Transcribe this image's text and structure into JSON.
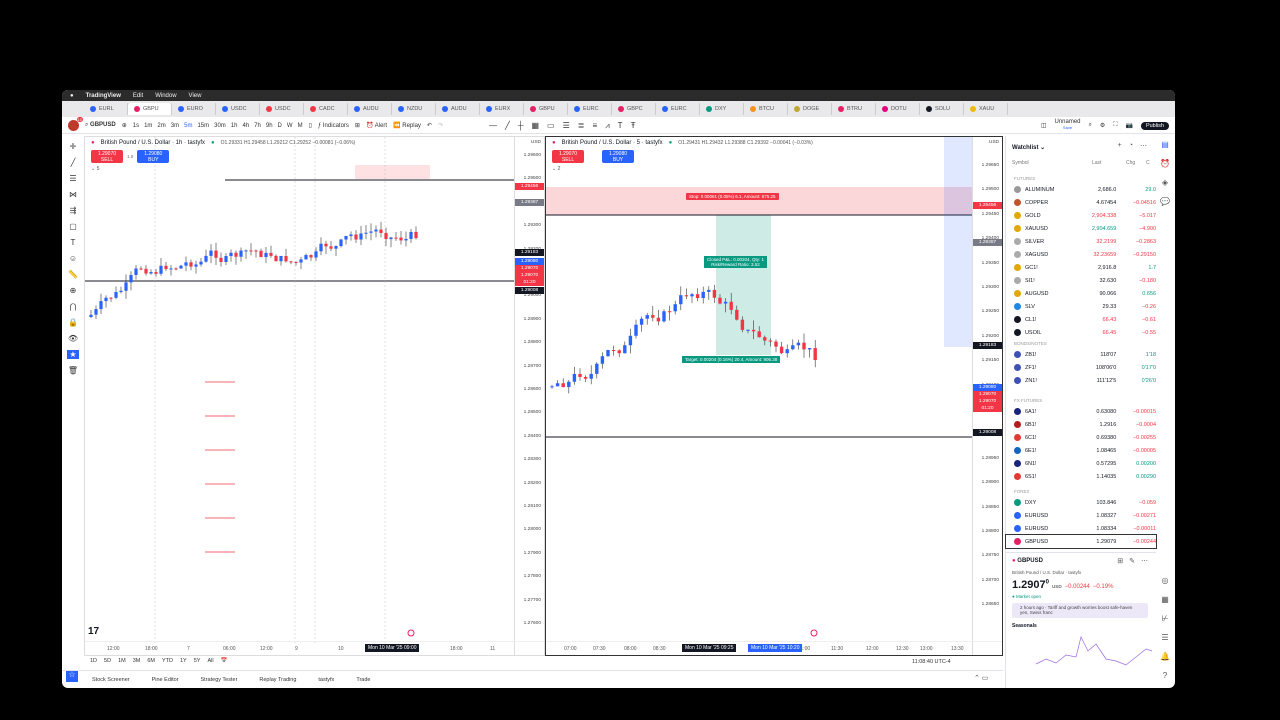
{
  "menubar": {
    "app": "TradingView",
    "items": [
      "Edit",
      "Window",
      "View"
    ]
  },
  "tabs": [
    {
      "label": "EURL",
      "color": "#2962ff"
    },
    {
      "label": "GBPU",
      "color": "#e91e63",
      "active": true
    },
    {
      "label": "EURO",
      "color": "#2962ff"
    },
    {
      "label": "USDC",
      "color": "#2962ff"
    },
    {
      "label": "USDC",
      "color": "#f23645"
    },
    {
      "label": "CADC",
      "color": "#f23645"
    },
    {
      "label": "AUDU",
      "color": "#2962ff"
    },
    {
      "label": "NZDU",
      "color": "#2962ff"
    },
    {
      "label": "AUDU",
      "color": "#2962ff"
    },
    {
      "label": "EURX",
      "color": "#2962ff"
    },
    {
      "label": "GBPU",
      "color": "#e91e63"
    },
    {
      "label": "EURC",
      "color": "#2962ff"
    },
    {
      "label": "GBPC",
      "color": "#e91e63"
    },
    {
      "label": "EURC",
      "color": "#2962ff"
    },
    {
      "label": "DXY",
      "color": "#089981"
    },
    {
      "label": "BTCU",
      "color": "#f7931a"
    },
    {
      "label": "DOGE",
      "color": "#c2a633"
    },
    {
      "label": "BTRU",
      "color": "#e91e63"
    },
    {
      "label": "DOTU",
      "color": "#e6007a"
    },
    {
      "label": "SOLU",
      "color": "#131722"
    },
    {
      "label": "XAUU",
      "color": "#f0b90b"
    }
  ],
  "toolbar": {
    "avatar_badge": "10",
    "symbol": "GBPUSD",
    "intervals": [
      "1s",
      "1m",
      "2m",
      "3m",
      "5m",
      "15m",
      "30m",
      "1h",
      "4h",
      "7h",
      "9h",
      "D",
      "W",
      "M"
    ],
    "active_interval": "5m",
    "indicators": "Indicators",
    "alert": "Alert",
    "replay": "Replay",
    "layout_name": "Unnamed",
    "layout_status": "Save",
    "publish": "Publish"
  },
  "chart1": {
    "title": "British Pound / U.S. Dollar · 1h · tastyfx",
    "ohlc": "O1.29331 H1.29458 L1.29212 C1.29252 −0.00081 (−0.06%)",
    "sell_price": "1.29070",
    "sell": "SELL",
    "spread": "1.0",
    "buy_price": "1.29080",
    "buy": "BUY",
    "lots": "5",
    "currency": "USD",
    "price_labels": [
      "1.29600",
      "1.29500",
      "1.29400",
      "1.29300",
      "1.29200",
      "1.29100",
      "1.29000",
      "1.28900",
      "1.28800",
      "1.28700",
      "1.28600",
      "1.28500",
      "1.28400",
      "1.28300",
      "1.28200",
      "1.28100",
      "1.28000",
      "1.27900",
      "1.27800",
      "1.27700",
      "1.27600"
    ],
    "tags": {
      "stop": "1.29456",
      "entry": "1.29387",
      "last": "1.29183",
      "ask_label": "Ask",
      "ask": "1.29080",
      "bid_label": "Bid",
      "bid": "1.29070",
      "sym": "GBPUSD",
      "sym_price": "1.29070",
      "countdown": "01:20",
      "line": "1.29008"
    },
    "time_labels": [
      "12:00",
      "18:00",
      "7",
      "06:00",
      "12:00",
      "9",
      "10",
      "18:00",
      "11"
    ],
    "crosshair_time": "Mon 10 Mar '25  09:00"
  },
  "chart2": {
    "title": "British Pound / U.S. Dollar · 5 · tastyfx",
    "ohlc": "O1.29431 H1.29432 L1.29388 C1.29392 −0.00041 (−0.03%)",
    "sell_price": "1.29070",
    "sell": "SELL",
    "buy_price": "1.29080",
    "buy": "BUY",
    "lots": "2",
    "currency": "USD",
    "price_labels": [
      "1.29650",
      "1.29500",
      "1.29450",
      "1.29400",
      "1.29350",
      "1.29300",
      "1.29250",
      "1.29200",
      "1.29150",
      "1.29100",
      "1.29050",
      "1.29000",
      "1.28950",
      "1.28900",
      "1.28850",
      "1.28800",
      "1.28750",
      "1.28700",
      "1.28650"
    ],
    "stop_label": "Stop: 0.00061 (0.05%) 6.1, Amount: 675.25",
    "pnl_label": "Closed P&L: 0.00204, Qty: 1",
    "rr_label": "Risk/Reward Ratio: 3.52",
    "target_label": "Target: 0.00204 (0.16%) 20.4, Amount: 906.38",
    "time_labels": [
      "07:00",
      "07:30",
      "08:00",
      "08:30",
      "11:00",
      "11:30",
      "12:00",
      "12:30",
      "13:00",
      "13:30"
    ],
    "range_start": "Mon 10 Mar '25  09:25",
    "range_end": "Mon 10 Mar '25  10:20"
  },
  "rangebar": [
    "1D",
    "5D",
    "1M",
    "3M",
    "6M",
    "YTD",
    "1Y",
    "5Y",
    "All"
  ],
  "clock": "11:08:40 UTC-4",
  "bottom_tabs": [
    "Stock Screener",
    "Pine Editor",
    "Strategy Tester",
    "Replay Trading",
    "tastyfx",
    "Trade"
  ],
  "watchlist": {
    "title": "Watchlist",
    "col_symbol": "Symbol",
    "col_last": "Last",
    "col_chg": "Chg",
    "col_chgp": "C",
    "sections": [
      "FUTURES",
      "BONDS/NOTES",
      "FX FUTURES",
      "FOREX"
    ],
    "rows": [
      {
        "sym": "ALUMINUM",
        "last": "2,686.0",
        "chg": "29.0",
        "icon": "#999",
        "up": true
      },
      {
        "sym": "COPPER",
        "last": "4.67454",
        "chg": "−0.04516",
        "icon": "#c0552b"
      },
      {
        "sym": "GOLD",
        "last": "2,904.338",
        "chg": "−5.017",
        "icon": "#e0a800",
        "lastred": true
      },
      {
        "sym": "XAUUSD",
        "last": "2,904.659",
        "chg": "−4.900",
        "icon": "#e0a800",
        "lastgreen": true
      },
      {
        "sym": "SILVER",
        "last": "32.2199",
        "chg": "−0.2863",
        "icon": "#aaa",
        "lastred": true
      },
      {
        "sym": "XAGUSD",
        "last": "32.23659",
        "chg": "−0.29150",
        "icon": "#aaa",
        "lastred": true
      },
      {
        "sym": "GC1!",
        "last": "2,916.8",
        "chg": "1.7",
        "icon": "#e0a800",
        "up": true
      },
      {
        "sym": "SI1!",
        "last": "32.630",
        "chg": "−0.180",
        "icon": "#aaa"
      },
      {
        "sym": "AUGUSD",
        "last": "90.066",
        "chg": "0.656",
        "icon": "#e0a800",
        "up": true
      },
      {
        "sym": "SLV",
        "last": "29.33",
        "chg": "−0.26",
        "icon": "#1e88e5"
      },
      {
        "sym": "CL1!",
        "last": "66.43",
        "chg": "−0.61",
        "icon": "#131722",
        "lastred": true
      },
      {
        "sym": "USOIL",
        "last": "66.45",
        "chg": "−0.55",
        "icon": "#131722",
        "lastred": true
      },
      {
        "sym": "ZB1!",
        "last": "118'07",
        "chg": "1'18",
        "icon": "#3f51b5",
        "up": true
      },
      {
        "sym": "ZF1!",
        "last": "108'06'0",
        "chg": "0'17'0",
        "icon": "#3f51b5",
        "up": true
      },
      {
        "sym": "ZN1!",
        "last": "111'12'5",
        "chg": "0'26'0",
        "icon": "#3f51b5",
        "up": true
      },
      {
        "sym": "6A1!",
        "last": "0.63080",
        "chg": "−0.00015",
        "icon": "#1a237e"
      },
      {
        "sym": "6B1!",
        "last": "1.2916",
        "chg": "−0.0004",
        "icon": "#b71c1c"
      },
      {
        "sym": "6C1!",
        "last": "0.69380",
        "chg": "−0.00255",
        "icon": "#e53935"
      },
      {
        "sym": "6E1!",
        "last": "1.08465",
        "chg": "−0.00005",
        "icon": "#1565c0"
      },
      {
        "sym": "6N1!",
        "last": "0.57295",
        "chg": "0.00200",
        "icon": "#1a237e",
        "up": true
      },
      {
        "sym": "6S1!",
        "last": "1.14035",
        "chg": "0.00290",
        "icon": "#e53935",
        "up": true
      },
      {
        "sym": "DXY",
        "last": "103.846",
        "chg": "−0.059",
        "icon": "#089981"
      },
      {
        "sym": "EURUSD",
        "last": "1.08327",
        "chg": "−0.00271",
        "icon": "#2962ff"
      },
      {
        "sym": "EURUSD",
        "last": "1.08334",
        "chg": "−0.00011",
        "icon": "#2962ff"
      },
      {
        "sym": "GBPUSD",
        "last": "1.29079",
        "chg": "−0.00244",
        "icon": "#e91e63",
        "selected": true
      }
    ]
  },
  "details": {
    "symbol": "GBPUSD",
    "name": "British Pound / U.S. Dollar · tastyfx",
    "price": "1.2907",
    "price_sup": "0",
    "currency": "USD",
    "change": "−0.00244",
    "change_pct": "−0.19%",
    "status": "Market open",
    "news": "2 hours ago · Tariff and growth worries boost safe-haven yen, Swiss franc",
    "seasonals": "Seasonals"
  },
  "colors": {
    "up": "#2962ff",
    "down": "#f23645",
    "green": "#089981"
  }
}
